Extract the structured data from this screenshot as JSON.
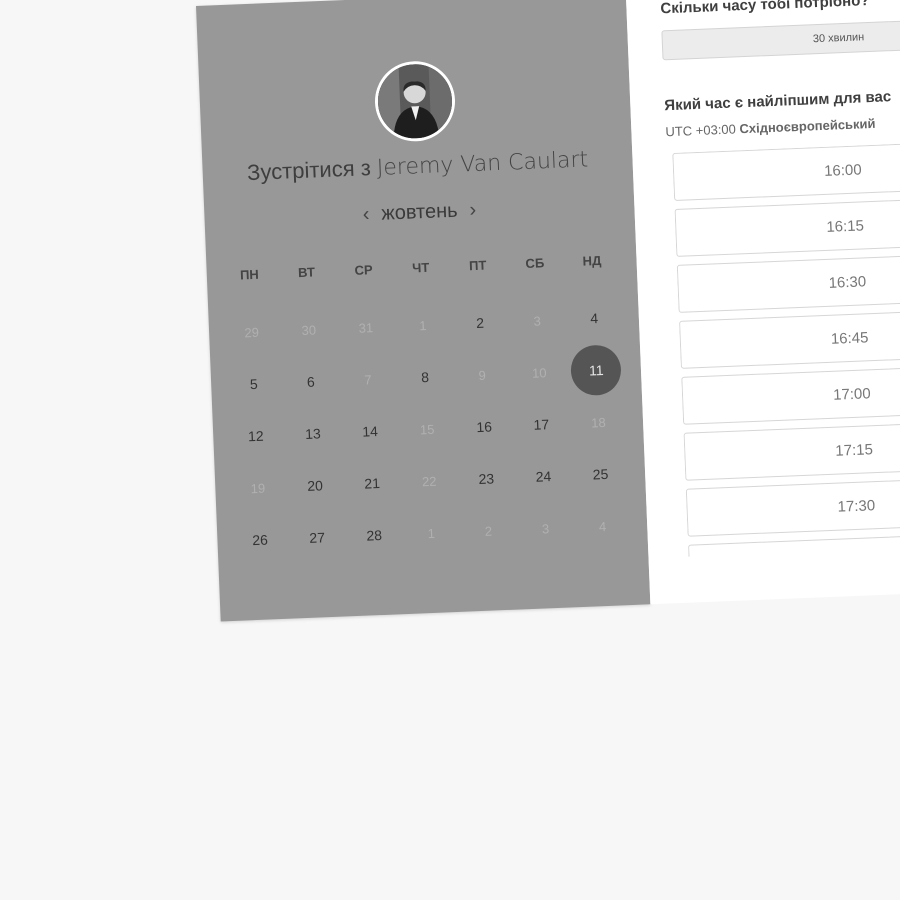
{
  "host": {
    "title_prefix": "Зустрітися з",
    "name": "Jeremy Van Caulart"
  },
  "calendar": {
    "month": "жовтень",
    "prev_arrow": "‹",
    "next_arrow": "›",
    "weekdays": [
      "ПН",
      "ВТ",
      "СР",
      "ЧТ",
      "ПТ",
      "СБ",
      "НД"
    ],
    "days": [
      {
        "label": "29",
        "muted": true
      },
      {
        "label": "30",
        "muted": true
      },
      {
        "label": "31",
        "muted": true
      },
      {
        "label": "1",
        "muted": true
      },
      {
        "label": "2",
        "muted": false
      },
      {
        "label": "3",
        "muted": true
      },
      {
        "label": "4",
        "muted": false
      },
      {
        "label": "5",
        "muted": false
      },
      {
        "label": "6",
        "muted": false
      },
      {
        "label": "7",
        "muted": true
      },
      {
        "label": "8",
        "muted": false
      },
      {
        "label": "9",
        "muted": true
      },
      {
        "label": "10",
        "muted": true
      },
      {
        "label": "11",
        "muted": false,
        "selected": true
      },
      {
        "label": "12",
        "muted": false
      },
      {
        "label": "13",
        "muted": false
      },
      {
        "label": "14",
        "muted": false
      },
      {
        "label": "15",
        "muted": true
      },
      {
        "label": "16",
        "muted": false
      },
      {
        "label": "17",
        "muted": false
      },
      {
        "label": "18",
        "muted": true
      },
      {
        "label": "19",
        "muted": true
      },
      {
        "label": "20",
        "muted": false
      },
      {
        "label": "21",
        "muted": false
      },
      {
        "label": "22",
        "muted": true
      },
      {
        "label": "23",
        "muted": false
      },
      {
        "label": "24",
        "muted": false
      },
      {
        "label": "25",
        "muted": false
      },
      {
        "label": "26",
        "muted": false
      },
      {
        "label": "27",
        "muted": false
      },
      {
        "label": "28",
        "muted": false
      },
      {
        "label": "1",
        "muted": true
      },
      {
        "label": "2",
        "muted": true
      },
      {
        "label": "3",
        "muted": true
      },
      {
        "label": "4",
        "muted": true
      }
    ]
  },
  "booking": {
    "duration_question": "Скільки часу тобі потрібно?",
    "duration_value": "30 хвилин",
    "time_question": "Який час є найліпшим для вас",
    "timezone_offset": "UTC +03:00",
    "timezone_name": "Східноєвропейський",
    "slots": [
      "16:00",
      "16:15",
      "16:30",
      "16:45",
      "17:00",
      "17:15",
      "17:30",
      ""
    ]
  },
  "colors": {
    "left_panel": "#989898",
    "selected_day": "#555555",
    "page_background": "#f7f7f7"
  }
}
